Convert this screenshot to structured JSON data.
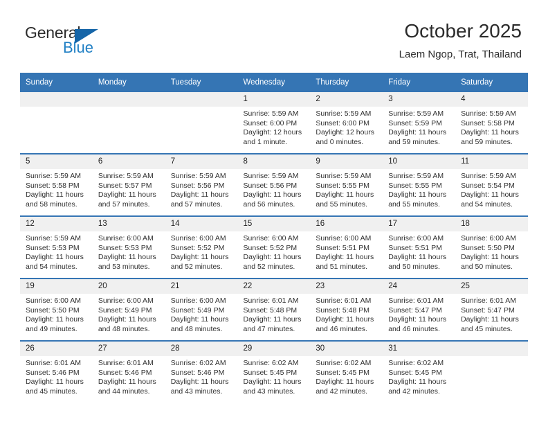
{
  "brand": {
    "name_part1": "General",
    "name_part2": "Blue",
    "accent_color": "#1565a8"
  },
  "header": {
    "month_title": "October 2025",
    "location": "Laem Ngop, Trat, Thailand"
  },
  "calendar": {
    "header_color": "#3575b4",
    "weekday_headers": [
      "Sunday",
      "Monday",
      "Tuesday",
      "Wednesday",
      "Thursday",
      "Friday",
      "Saturday"
    ],
    "weeks": [
      [
        {
          "day": "",
          "empty": true,
          "sunrise": "",
          "sunset": "",
          "daylight_line1": "",
          "daylight_line2": ""
        },
        {
          "day": "",
          "empty": true,
          "sunrise": "",
          "sunset": "",
          "daylight_line1": "",
          "daylight_line2": ""
        },
        {
          "day": "",
          "empty": true,
          "sunrise": "",
          "sunset": "",
          "daylight_line1": "",
          "daylight_line2": ""
        },
        {
          "day": "1",
          "empty": false,
          "sunrise": "Sunrise: 5:59 AM",
          "sunset": "Sunset: 6:00 PM",
          "daylight_line1": "Daylight: 12 hours",
          "daylight_line2": "and 1 minute."
        },
        {
          "day": "2",
          "empty": false,
          "sunrise": "Sunrise: 5:59 AM",
          "sunset": "Sunset: 6:00 PM",
          "daylight_line1": "Daylight: 12 hours",
          "daylight_line2": "and 0 minutes."
        },
        {
          "day": "3",
          "empty": false,
          "sunrise": "Sunrise: 5:59 AM",
          "sunset": "Sunset: 5:59 PM",
          "daylight_line1": "Daylight: 11 hours",
          "daylight_line2": "and 59 minutes."
        },
        {
          "day": "4",
          "empty": false,
          "sunrise": "Sunrise: 5:59 AM",
          "sunset": "Sunset: 5:58 PM",
          "daylight_line1": "Daylight: 11 hours",
          "daylight_line2": "and 59 minutes."
        }
      ],
      [
        {
          "day": "5",
          "empty": false,
          "sunrise": "Sunrise: 5:59 AM",
          "sunset": "Sunset: 5:58 PM",
          "daylight_line1": "Daylight: 11 hours",
          "daylight_line2": "and 58 minutes."
        },
        {
          "day": "6",
          "empty": false,
          "sunrise": "Sunrise: 5:59 AM",
          "sunset": "Sunset: 5:57 PM",
          "daylight_line1": "Daylight: 11 hours",
          "daylight_line2": "and 57 minutes."
        },
        {
          "day": "7",
          "empty": false,
          "sunrise": "Sunrise: 5:59 AM",
          "sunset": "Sunset: 5:56 PM",
          "daylight_line1": "Daylight: 11 hours",
          "daylight_line2": "and 57 minutes."
        },
        {
          "day": "8",
          "empty": false,
          "sunrise": "Sunrise: 5:59 AM",
          "sunset": "Sunset: 5:56 PM",
          "daylight_line1": "Daylight: 11 hours",
          "daylight_line2": "and 56 minutes."
        },
        {
          "day": "9",
          "empty": false,
          "sunrise": "Sunrise: 5:59 AM",
          "sunset": "Sunset: 5:55 PM",
          "daylight_line1": "Daylight: 11 hours",
          "daylight_line2": "and 55 minutes."
        },
        {
          "day": "10",
          "empty": false,
          "sunrise": "Sunrise: 5:59 AM",
          "sunset": "Sunset: 5:55 PM",
          "daylight_line1": "Daylight: 11 hours",
          "daylight_line2": "and 55 minutes."
        },
        {
          "day": "11",
          "empty": false,
          "sunrise": "Sunrise: 5:59 AM",
          "sunset": "Sunset: 5:54 PM",
          "daylight_line1": "Daylight: 11 hours",
          "daylight_line2": "and 54 minutes."
        }
      ],
      [
        {
          "day": "12",
          "empty": false,
          "sunrise": "Sunrise: 5:59 AM",
          "sunset": "Sunset: 5:53 PM",
          "daylight_line1": "Daylight: 11 hours",
          "daylight_line2": "and 54 minutes."
        },
        {
          "day": "13",
          "empty": false,
          "sunrise": "Sunrise: 6:00 AM",
          "sunset": "Sunset: 5:53 PM",
          "daylight_line1": "Daylight: 11 hours",
          "daylight_line2": "and 53 minutes."
        },
        {
          "day": "14",
          "empty": false,
          "sunrise": "Sunrise: 6:00 AM",
          "sunset": "Sunset: 5:52 PM",
          "daylight_line1": "Daylight: 11 hours",
          "daylight_line2": "and 52 minutes."
        },
        {
          "day": "15",
          "empty": false,
          "sunrise": "Sunrise: 6:00 AM",
          "sunset": "Sunset: 5:52 PM",
          "daylight_line1": "Daylight: 11 hours",
          "daylight_line2": "and 52 minutes."
        },
        {
          "day": "16",
          "empty": false,
          "sunrise": "Sunrise: 6:00 AM",
          "sunset": "Sunset: 5:51 PM",
          "daylight_line1": "Daylight: 11 hours",
          "daylight_line2": "and 51 minutes."
        },
        {
          "day": "17",
          "empty": false,
          "sunrise": "Sunrise: 6:00 AM",
          "sunset": "Sunset: 5:51 PM",
          "daylight_line1": "Daylight: 11 hours",
          "daylight_line2": "and 50 minutes."
        },
        {
          "day": "18",
          "empty": false,
          "sunrise": "Sunrise: 6:00 AM",
          "sunset": "Sunset: 5:50 PM",
          "daylight_line1": "Daylight: 11 hours",
          "daylight_line2": "and 50 minutes."
        }
      ],
      [
        {
          "day": "19",
          "empty": false,
          "sunrise": "Sunrise: 6:00 AM",
          "sunset": "Sunset: 5:50 PM",
          "daylight_line1": "Daylight: 11 hours",
          "daylight_line2": "and 49 minutes."
        },
        {
          "day": "20",
          "empty": false,
          "sunrise": "Sunrise: 6:00 AM",
          "sunset": "Sunset: 5:49 PM",
          "daylight_line1": "Daylight: 11 hours",
          "daylight_line2": "and 48 minutes."
        },
        {
          "day": "21",
          "empty": false,
          "sunrise": "Sunrise: 6:00 AM",
          "sunset": "Sunset: 5:49 PM",
          "daylight_line1": "Daylight: 11 hours",
          "daylight_line2": "and 48 minutes."
        },
        {
          "day": "22",
          "empty": false,
          "sunrise": "Sunrise: 6:01 AM",
          "sunset": "Sunset: 5:48 PM",
          "daylight_line1": "Daylight: 11 hours",
          "daylight_line2": "and 47 minutes."
        },
        {
          "day": "23",
          "empty": false,
          "sunrise": "Sunrise: 6:01 AM",
          "sunset": "Sunset: 5:48 PM",
          "daylight_line1": "Daylight: 11 hours",
          "daylight_line2": "and 46 minutes."
        },
        {
          "day": "24",
          "empty": false,
          "sunrise": "Sunrise: 6:01 AM",
          "sunset": "Sunset: 5:47 PM",
          "daylight_line1": "Daylight: 11 hours",
          "daylight_line2": "and 46 minutes."
        },
        {
          "day": "25",
          "empty": false,
          "sunrise": "Sunrise: 6:01 AM",
          "sunset": "Sunset: 5:47 PM",
          "daylight_line1": "Daylight: 11 hours",
          "daylight_line2": "and 45 minutes."
        }
      ],
      [
        {
          "day": "26",
          "empty": false,
          "sunrise": "Sunrise: 6:01 AM",
          "sunset": "Sunset: 5:46 PM",
          "daylight_line1": "Daylight: 11 hours",
          "daylight_line2": "and 45 minutes."
        },
        {
          "day": "27",
          "empty": false,
          "sunrise": "Sunrise: 6:01 AM",
          "sunset": "Sunset: 5:46 PM",
          "daylight_line1": "Daylight: 11 hours",
          "daylight_line2": "and 44 minutes."
        },
        {
          "day": "28",
          "empty": false,
          "sunrise": "Sunrise: 6:02 AM",
          "sunset": "Sunset: 5:46 PM",
          "daylight_line1": "Daylight: 11 hours",
          "daylight_line2": "and 43 minutes."
        },
        {
          "day": "29",
          "empty": false,
          "sunrise": "Sunrise: 6:02 AM",
          "sunset": "Sunset: 5:45 PM",
          "daylight_line1": "Daylight: 11 hours",
          "daylight_line2": "and 43 minutes."
        },
        {
          "day": "30",
          "empty": false,
          "sunrise": "Sunrise: 6:02 AM",
          "sunset": "Sunset: 5:45 PM",
          "daylight_line1": "Daylight: 11 hours",
          "daylight_line2": "and 42 minutes."
        },
        {
          "day": "31",
          "empty": false,
          "sunrise": "Sunrise: 6:02 AM",
          "sunset": "Sunset: 5:45 PM",
          "daylight_line1": "Daylight: 11 hours",
          "daylight_line2": "and 42 minutes."
        },
        {
          "day": "",
          "empty": true,
          "sunrise": "",
          "sunset": "",
          "daylight_line1": "",
          "daylight_line2": ""
        }
      ]
    ]
  }
}
